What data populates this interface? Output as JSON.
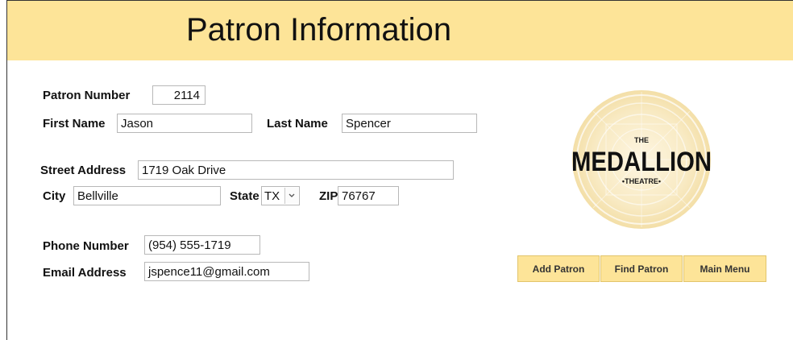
{
  "form": {
    "title": "Patron Information",
    "labels": {
      "patron_number": "Patron Number",
      "first_name": "First Name",
      "last_name": "Last Name",
      "street_address": "Street Address",
      "city": "City",
      "state": "State",
      "zip": "ZIP",
      "phone_number": "Phone Number",
      "email_address": "Email Address"
    },
    "values": {
      "patron_number": "2114",
      "first_name": "Jason",
      "last_name": "Spencer",
      "street_address": "1719 Oak Drive",
      "city": "Bellville",
      "state": "TX",
      "zip": "76767",
      "phone_number": "(954) 555-1719",
      "email_address": "jspence11@gmail.com"
    }
  },
  "buttons": {
    "add_patron": "Add Patron",
    "find_patron": "Find Patron",
    "main_menu": "Main Menu"
  },
  "logo": {
    "line1": "THE",
    "line2": "MEDALLION",
    "line3": "•THEATRE•"
  },
  "colors": {
    "header_bg": "#fde498",
    "button_bg": "#fde498",
    "logo_medallion": "#f3dc9f"
  }
}
